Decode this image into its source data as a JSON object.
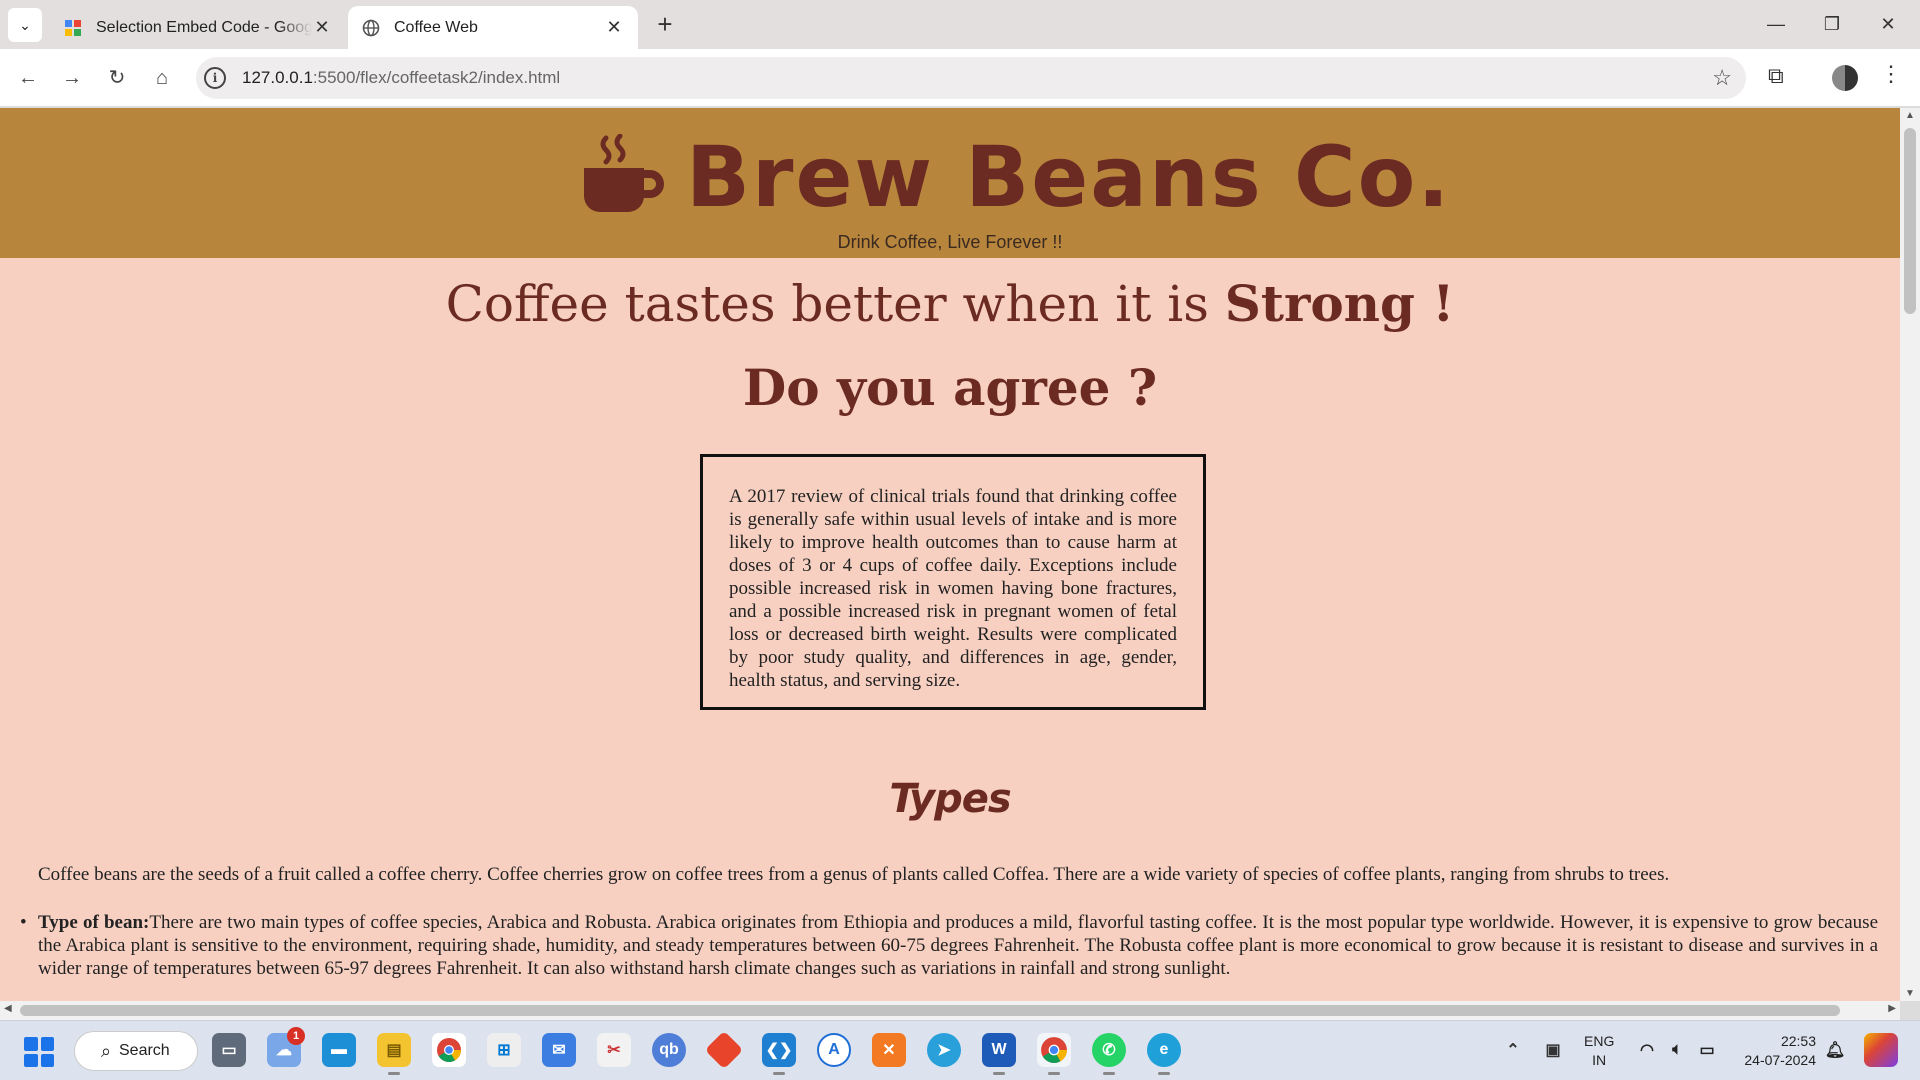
{
  "browser": {
    "tabs": [
      {
        "title": "Selection Embed Code - Google",
        "active": false,
        "favicon": "google-apps-icon"
      },
      {
        "title": "Coffee Web",
        "active": true,
        "favicon": "globe-icon"
      }
    ],
    "url_host": "127.0.0.1",
    "url_path": ":5500/flex/coffeetask2/index.html"
  },
  "site": {
    "brand": "Brew Beans Co.",
    "tagline": "Drink Coffee, Live Forever !!",
    "headline_plain": "Coffee tastes better when it is ",
    "headline_bold": "Strong !",
    "subheadline": "Do you agree ?",
    "infobox": "A 2017 review of clinical trials found that drinking coffee is generally safe within usual levels of intake and is more likely to improve health outcomes than to cause harm at doses of 3 or 4 cups of coffee daily. Exceptions include possible increased risk in women having bone fractures, and a possible increased risk in pregnant women of fetal loss or decreased birth weight. Results were complicated by poor study quality, and differences in age, gender, health status, and serving size.",
    "section_title": "Types",
    "intro_paragraph": "Coffee beans are the seeds of a fruit called a coffee cherry. Coffee cherries grow on coffee trees from a genus of plants called Coffea. There are a wide variety of species of coffee plants, ranging from shrubs to trees.",
    "bullet_label": "Type of bean:",
    "bullet_text": "There are two main types of coffee species, Arabica and Robusta. Arabica originates from Ethiopia and produces a mild, flavorful tasting coffee. It is the most popular type worldwide. However, it is expensive to grow because the Arabica plant is sensitive to the environment, requiring shade, humidity, and steady temperatures between 60-75 degrees Fahrenheit. The Robusta coffee plant is more economical to grow because it is resistant to disease and survives in a wider range of temperatures between 65-97 degrees Fahrenheit. It can also withstand harsh climate changes such as variations in rainfall and strong sunlight."
  },
  "colors": {
    "header_bg": "#b8853d",
    "page_bg": "#f7d0c2",
    "brand_text": "#6b2a22"
  },
  "taskbar": {
    "search_label": "Search",
    "weather_badge": "1",
    "lang_line1": "ENG",
    "lang_line2": "IN",
    "time": "22:53",
    "date": "24-07-2024"
  }
}
